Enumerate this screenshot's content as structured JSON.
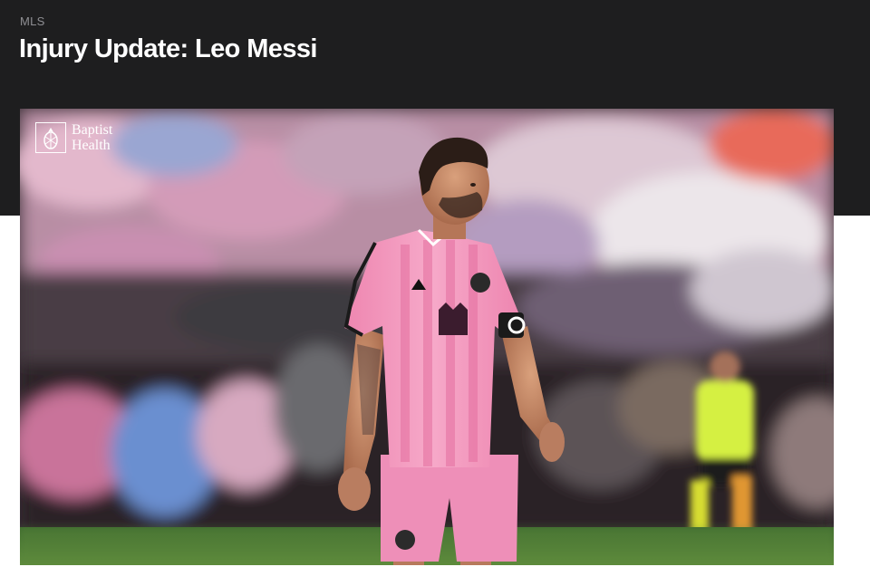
{
  "article": {
    "category": "MLS",
    "title": "Injury Update: Leo Messi"
  },
  "hero_image": {
    "description_icon": "player-photo",
    "sponsor": {
      "line1": "Baptist",
      "line2": "Health",
      "icon": "pineapple-icon"
    }
  },
  "colors": {
    "header_bg": "#1e1e1f",
    "title": "#ffffff",
    "category": "#8f8f93",
    "jersey_pink": "#f08db5"
  }
}
